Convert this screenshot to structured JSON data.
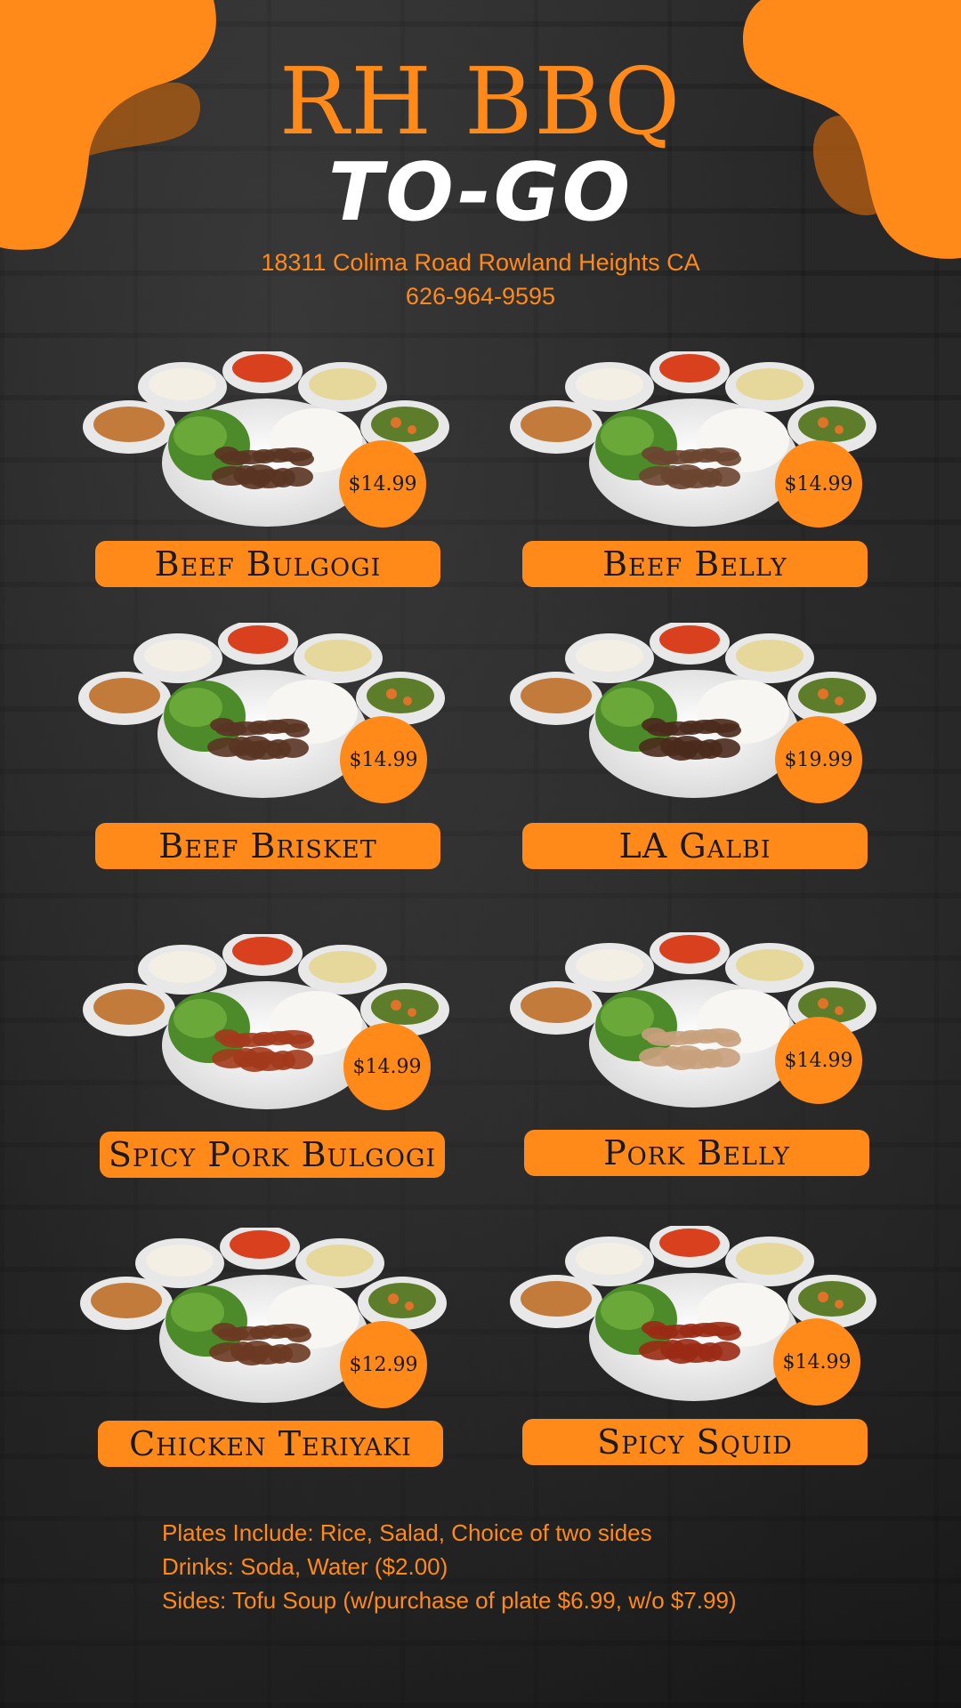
{
  "header": {
    "title": "RH BBQ",
    "subtitle": "TO-GO",
    "address": "18311 Colima Road Rowland Heights CA",
    "phone": "626-964-9595"
  },
  "menu": [
    {
      "name": "Beef Bulgogi",
      "price": "$14.99"
    },
    {
      "name": "Beef Belly",
      "price": "$14.99"
    },
    {
      "name": "Beef Brisket",
      "price": "$14.99"
    },
    {
      "name": "LA Galbi",
      "price": "$19.99"
    },
    {
      "name": "Spicy Pork Bulgogi",
      "price": "$14.99"
    },
    {
      "name": "Pork Belly",
      "price": "$14.99"
    },
    {
      "name": "Chicken Teriyaki",
      "price": "$12.99"
    },
    {
      "name": "Spicy Squid",
      "price": "$14.99"
    }
  ],
  "footer": {
    "line1": "Plates Include: Rice, Salad, Choice of two sides",
    "line2": "Drinks: Soda, Water ($2.00)",
    "line3": "Sides: Tofu Soup (w/purchase of plate $6.99, w/o $7.99)"
  },
  "colors": {
    "accent": "#ff8a1a",
    "background": "#1f1f1f"
  }
}
